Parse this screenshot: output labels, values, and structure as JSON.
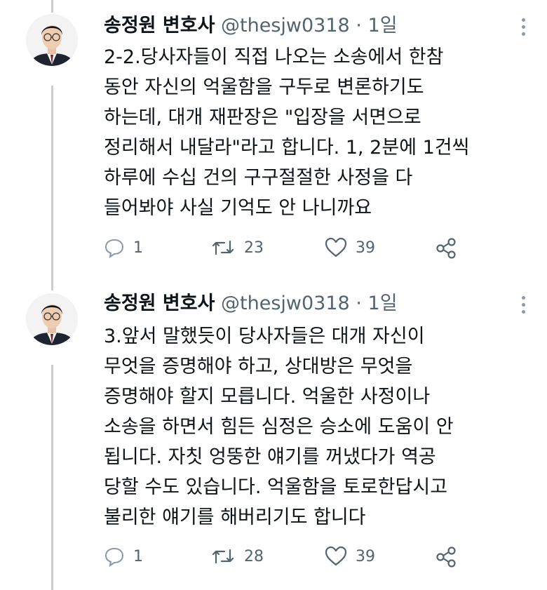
{
  "tweets": [
    {
      "author_name": "송정원 변호사",
      "handle": "@thesjw0318",
      "separator": "·",
      "time": "1일",
      "text": "2-2.당사자들이 직접 나오는 소송에서 한참\n동안 자신의 억울함을 구두로 변론하기도\n하는데, 대개 재판장은 \"입장을 서면으로\n정리해서 내달라\"라고 합니다. 1, 2분에 1건씩\n하루에 수십 건의 구구절절한 사정을 다\n들어봐야 사실 기억도 안 나니까요",
      "replies": "1",
      "retweets": "23",
      "likes": "39"
    },
    {
      "author_name": "송정원 변호사",
      "handle": "@thesjw0318",
      "separator": "·",
      "time": "1일",
      "text": "3.앞서 말했듯이 당사자들은 대개 자신이\n무엇을 증명해야 하고,  상대방은 무엇을\n증명해야 할지 모릅니다. 억울한 사정이나\n소송을 하면서 힘든 심정은 승소에 도움이 안\n됩니다. 자칫 엉뚱한 얘기를 꺼냈다가 역공\n당할 수도 있습니다. 억울함을 토로한답시고\n불리한 얘기를 해버리기도 합니다",
      "replies": "1",
      "retweets": "28",
      "likes": "39"
    }
  ],
  "icons": {
    "reply": "reply-icon",
    "retweet": "retweet-icon",
    "like": "heart-icon",
    "share": "share-icon",
    "more": "more-icon"
  },
  "colors": {
    "text": "#0f1419",
    "secondary": "#536471",
    "thread_line": "#c9cdd1"
  }
}
